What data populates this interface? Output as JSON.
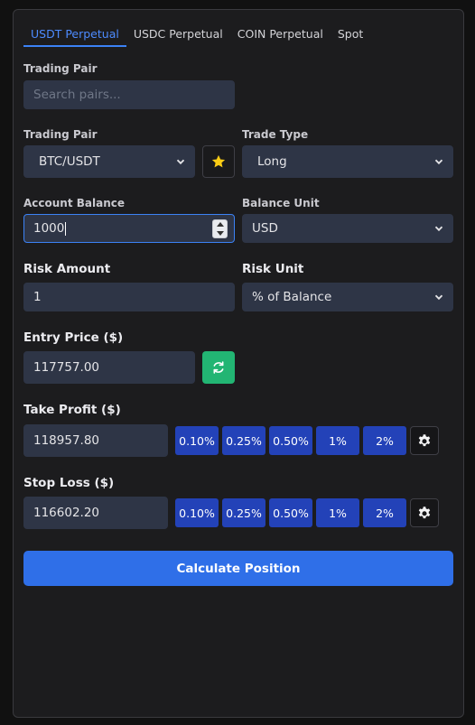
{
  "tabs": [
    {
      "label": "USDT Perpetual",
      "active": true
    },
    {
      "label": "USDC Perpetual",
      "active": false
    },
    {
      "label": "COIN Perpetual",
      "active": false
    },
    {
      "label": "Spot",
      "active": false
    }
  ],
  "search": {
    "label": "Trading Pair",
    "placeholder": "Search pairs..."
  },
  "pair": {
    "label": "Trading Pair",
    "value": "BTC/USDT",
    "favorite_icon": "star-icon"
  },
  "trade_type": {
    "label": "Trade Type",
    "value": "Long"
  },
  "balance": {
    "label": "Account Balance",
    "value": "1000"
  },
  "balance_unit": {
    "label": "Balance Unit",
    "value": "USD"
  },
  "risk": {
    "label": "Risk Amount",
    "value": "1"
  },
  "risk_unit": {
    "label": "Risk Unit",
    "value": "% of Balance"
  },
  "entry": {
    "label": "Entry Price ($)",
    "value": "117757.00",
    "refresh_icon": "refresh-icon"
  },
  "take_profit": {
    "label": "Take Profit ($)",
    "value": "118957.80",
    "presets": [
      "0.10%",
      "0.25%",
      "0.50%",
      "1%",
      "2%"
    ]
  },
  "stop_loss": {
    "label": "Stop Loss ($)",
    "value": "116602.20",
    "presets": [
      "0.10%",
      "0.25%",
      "0.50%",
      "1%",
      "2%"
    ]
  },
  "calculate_label": "Calculate Position",
  "colors": {
    "accent": "#3b82f6",
    "refresh": "#22b573",
    "preset": "#2342b8",
    "star": "#facc15"
  }
}
